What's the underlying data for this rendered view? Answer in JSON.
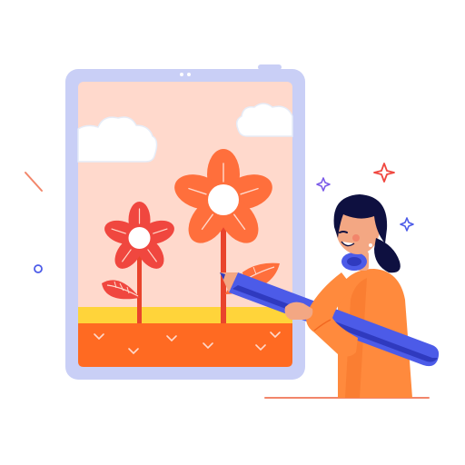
{
  "illustration": {
    "subject": "artist-drawing-flowers-on-tablet",
    "icons": [
      "tablet-icon",
      "cloud-icon",
      "flower-icon",
      "leaf-icon",
      "stylus-icon",
      "sparkle-icon",
      "person-icon"
    ]
  },
  "colors": {
    "tablet_frame": "#C9CFF6",
    "tablet_screen": "#FFD9CC",
    "cloud": "#FFFFFF",
    "cloud_outline": "#E6ECF7",
    "flower_red": "#F0473F",
    "flower_orange": "#FF6F3C",
    "flower_center": "#FFFFFF",
    "stem": "#E9442C",
    "ground_yellow": "#FFD43A",
    "ground_orange": "#FF6A22",
    "stylus": "#4C5BE8",
    "stylus_dark": "#2F3ABF",
    "sweater": "#FF8A3D",
    "sweater_shadow": "#F2661F",
    "hair": "#0E1040",
    "skin": "#F3A783",
    "headband": "#4C5BE8",
    "sparkle_red": "#F0473F",
    "sparkle_purple": "#7B5AE8",
    "sparkle_blue": "#4C5BE8",
    "accent_line": "#F2866A",
    "floor_line": "#F2866A"
  }
}
